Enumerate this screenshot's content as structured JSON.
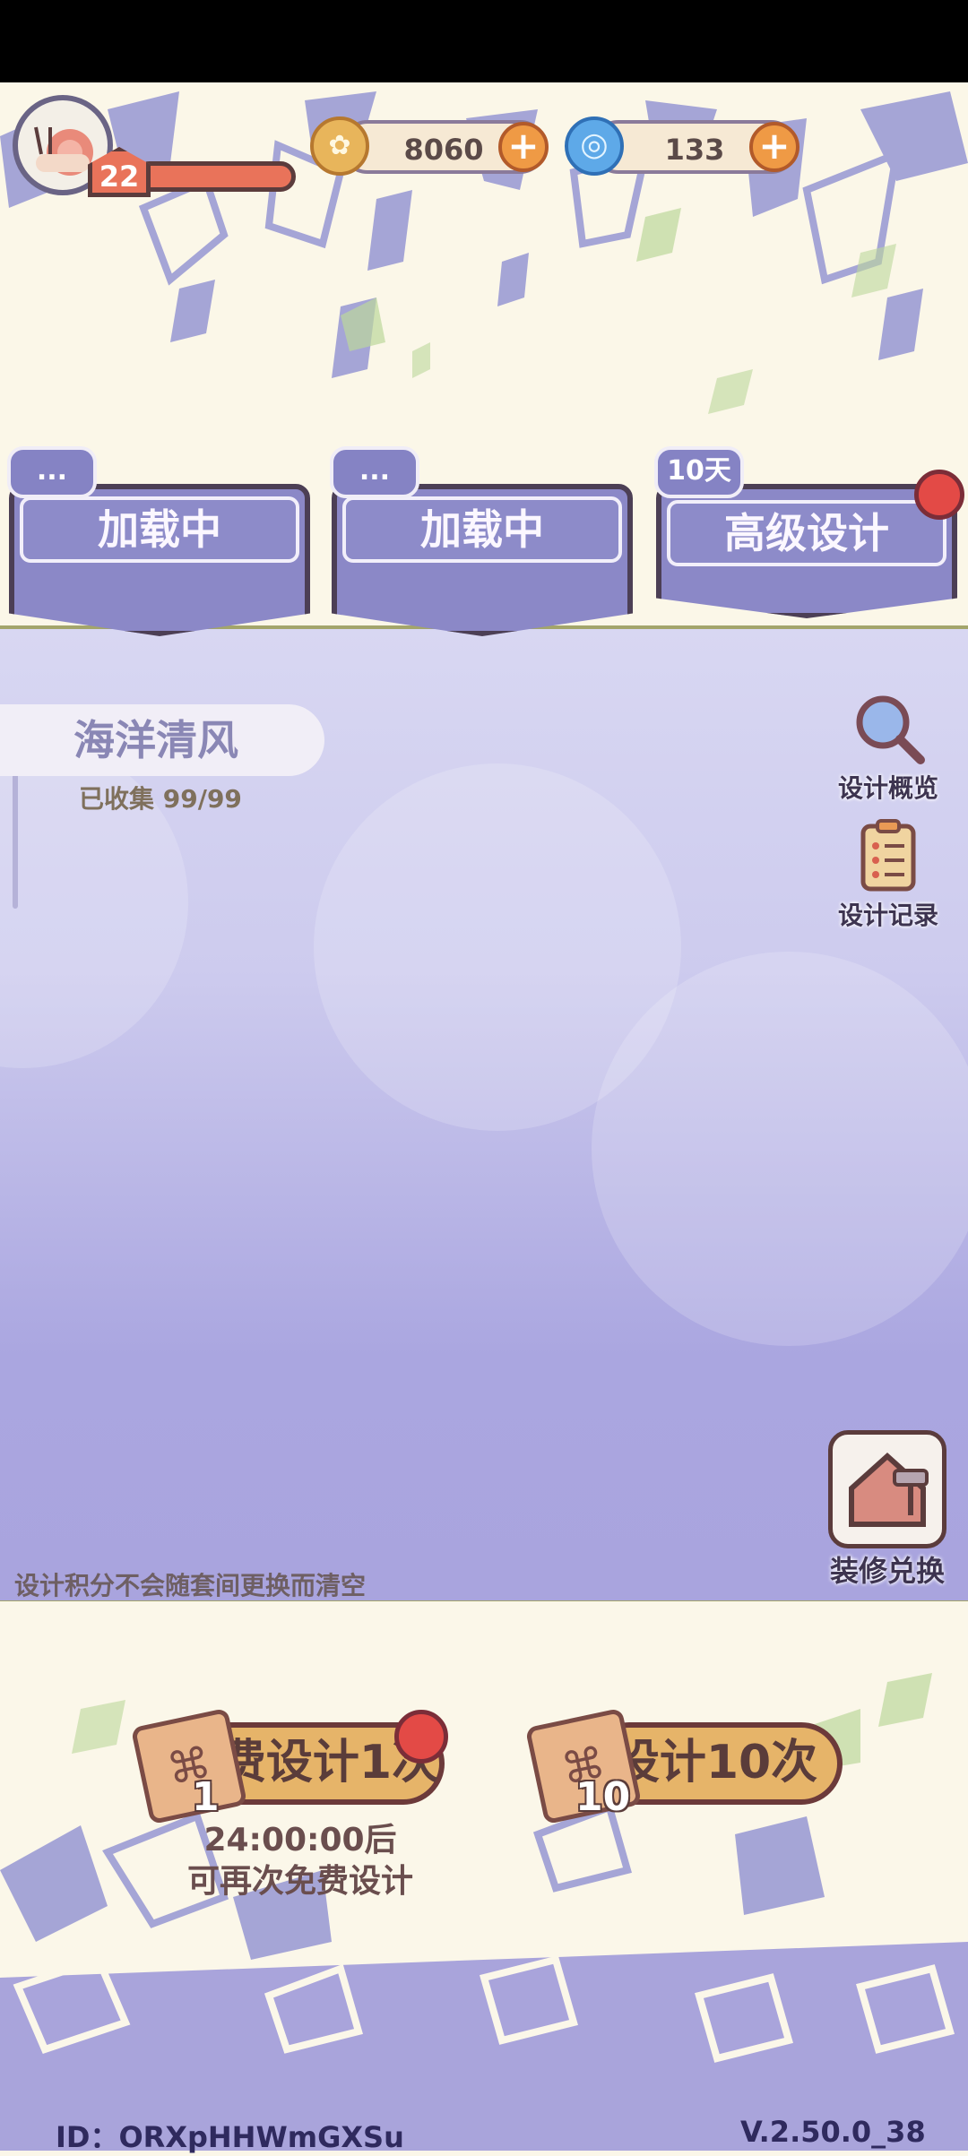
{
  "status_bar": {},
  "player": {
    "avatar_icon": "snail-avatar-icon",
    "level": "22",
    "level_progress": 0.95
  },
  "currencies": [
    {
      "icon": "coin-icon",
      "value": "8060"
    },
    {
      "icon": "gem-icon",
      "value": "133"
    }
  ],
  "banners": [
    {
      "tag": "...",
      "title": "加载中",
      "has_dot": false
    },
    {
      "tag": "...",
      "title": "加载中",
      "has_dot": false
    },
    {
      "tag": "10天",
      "title": "高级设计",
      "has_dot": true
    }
  ],
  "theme": {
    "name": "海洋清风",
    "collected": "已收集 99/99"
  },
  "side_tools": [
    {
      "icon": "magnifier-icon",
      "label": "设计概览"
    },
    {
      "icon": "clipboard-icon",
      "label": "设计记录"
    }
  ],
  "exchange": {
    "icon": "house-roller-icon",
    "label": "装修兑换"
  },
  "notice": "设计积分不会随套间更换而清空",
  "actions": {
    "free": {
      "label": "免费设计1次",
      "count": "1",
      "timer_line1": "24:00:00后",
      "timer_line2": "可再次免费设计"
    },
    "ten": {
      "label": "设计10次",
      "count": "10"
    }
  },
  "footer": {
    "id": "ID：ORXpHHWmGXSu",
    "version": "V.2.50.0_38"
  },
  "colors": {
    "accent_purple": "#8b88c7",
    "button_orange": "#e6b469",
    "dot_red": "#e34a46"
  }
}
